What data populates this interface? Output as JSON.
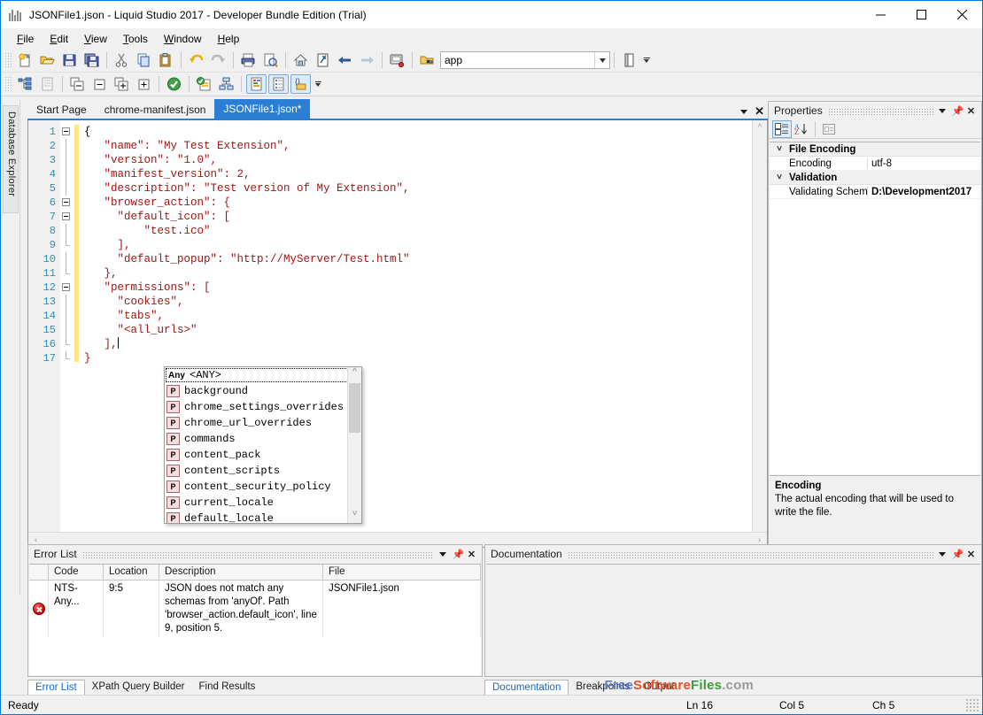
{
  "window": {
    "title": "JSONFile1.json - Liquid Studio 2017 - Developer Bundle Edition (Trial)",
    "minimize": "—",
    "maximize": "☐",
    "close": "✕"
  },
  "menu": {
    "items": [
      {
        "label": "File",
        "accel": "F"
      },
      {
        "label": "Edit",
        "accel": "E"
      },
      {
        "label": "View",
        "accel": "V"
      },
      {
        "label": "Tools",
        "accel": "T"
      },
      {
        "label": "Window",
        "accel": "W"
      },
      {
        "label": "Help",
        "accel": "H"
      }
    ]
  },
  "toolbar": {
    "row1": [
      "new-file-icon",
      "open-folder-icon",
      "save-icon",
      "save-all-icon",
      "cut-icon",
      "copy-icon",
      "paste-icon",
      "undo-icon",
      "redo-icon",
      "print-icon",
      "print-preview-icon",
      "home-icon",
      "navigate-icon",
      "back-arrow-icon",
      "forward-arrow-icon",
      "debug-icon",
      "find-in-files-icon"
    ],
    "combo_value": "app",
    "row2": [
      "tree-view-icon",
      "grid-view-icon",
      "collapse-all-icon",
      "collapse-icon",
      "expand-children-icon",
      "expand-all-icon",
      "validate-icon",
      "validate-schema-icon",
      "diagram-icon",
      "json-text-view-icon",
      "json-grid-view-icon",
      "json-schema-view-icon"
    ]
  },
  "left_dock": {
    "tab_label": "Database Explorer"
  },
  "document_tabs": {
    "tabs": [
      {
        "label": "Start Page",
        "active": false
      },
      {
        "label": "chrome-manifest.json",
        "active": false
      },
      {
        "label": "JSONFile1.json*",
        "active": true
      }
    ],
    "dropdown_icon": "chevron-down-icon",
    "close_icon": "close-icon"
  },
  "editor": {
    "line_numbers": [
      "1",
      "2",
      "3",
      "4",
      "5",
      "6",
      "7",
      "8",
      "9",
      "10",
      "11",
      "12",
      "13",
      "14",
      "15",
      "16",
      "17"
    ],
    "lines": [
      "{",
      "   \"name\": \"My Test Extension\",",
      "   \"version\": \"1.0\",",
      "   \"manifest_version\": 2,",
      "   \"description\": \"Test version of My Extension\",",
      "   \"browser_action\": {",
      "     \"default_icon\": [",
      "         \"test.ico\"",
      "     ],",
      "     \"default_popup\": \"http://MyServer/Test.html\"",
      "   },",
      "   \"permissions\": [",
      "     \"cookies\",",
      "     \"tabs\",",
      "     \"<all_urls>\"",
      "   ],",
      "}"
    ]
  },
  "autocomplete": {
    "header_icon_label": "Any",
    "header_value": "<ANY>",
    "item_icon_label": "P",
    "items": [
      "background",
      "chrome_settings_overrides",
      "chrome_url_overrides",
      "commands",
      "content_pack",
      "content_scripts",
      "content_security_policy",
      "current_locale",
      "default_locale"
    ]
  },
  "properties": {
    "title": "Properties",
    "toolbar": [
      "categorized-icon",
      "alphabetical-icon",
      "property-pages-icon"
    ],
    "groups": [
      {
        "name": "File Encoding",
        "rows": [
          {
            "name": "Encoding",
            "value": "utf-8",
            "selected": true
          }
        ]
      },
      {
        "name": "Validation",
        "rows": [
          {
            "name": "Validating Schem",
            "value": "D:\\Development2017",
            "selected": true
          }
        ]
      }
    ],
    "description": {
      "title": "Encoding",
      "text": "The actual encoding that will be used to write the file."
    }
  },
  "error_list": {
    "title": "Error List",
    "columns": [
      "",
      "Code",
      "Location",
      "Description",
      "File"
    ],
    "rows": [
      {
        "icon": "error-icon",
        "code": "NTS-Any...",
        "location": "9:5",
        "description": "JSON does not match any schemas from 'anyOf'. Path 'browser_action.default_icon', line 9, position 5.",
        "file": "JSONFile1.json"
      }
    ],
    "tabs": [
      {
        "label": "Error List",
        "active": true
      },
      {
        "label": "XPath Query Builder",
        "active": false
      },
      {
        "label": "Find Results",
        "active": false
      }
    ]
  },
  "documentation": {
    "title": "Documentation",
    "tabs": [
      {
        "label": "Documentation",
        "active": true
      },
      {
        "label": "Breakpoints",
        "active": false
      },
      {
        "label": "Output",
        "active": false
      }
    ]
  },
  "status_bar": {
    "ready": "Ready",
    "line": "Ln 16",
    "column": "Col 5",
    "character": "Ch 5"
  },
  "watermark": {
    "free": "Free",
    "software": "Software",
    "files": "Files",
    "com": ".com"
  },
  "colors": {
    "accent": "#2a7fd4",
    "title_border": "#0078d7",
    "line_number": "#2b91af",
    "string": "#a31515",
    "change_bar": "#ffe585",
    "error": "#c00000"
  }
}
